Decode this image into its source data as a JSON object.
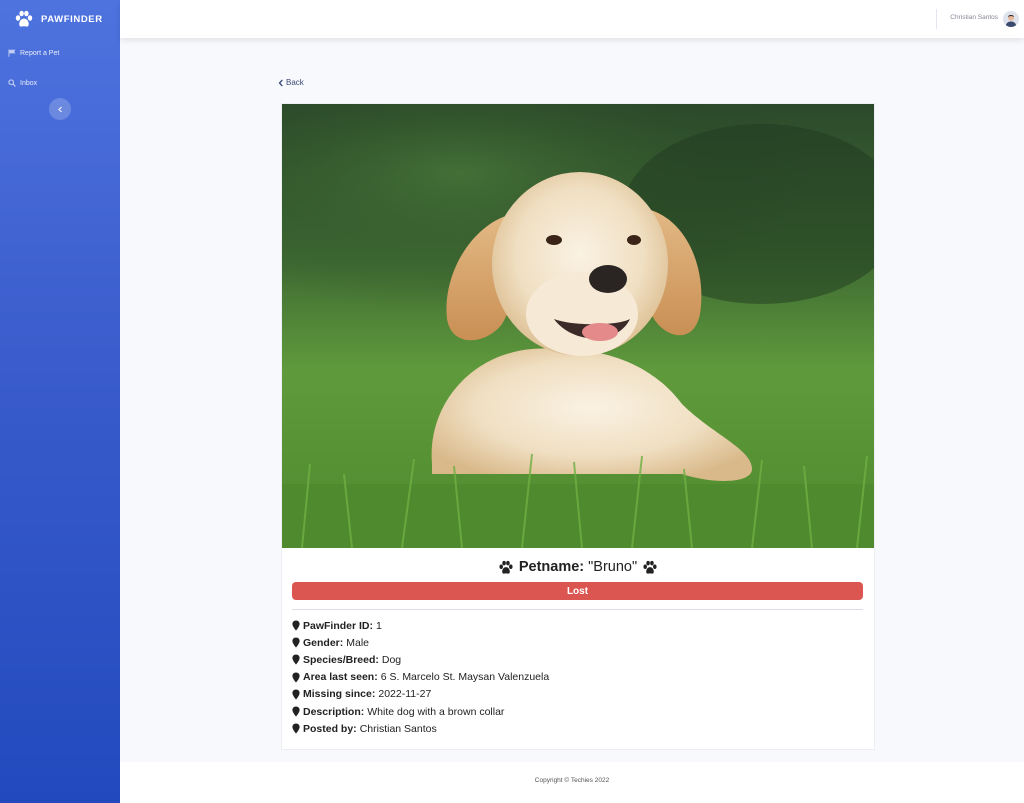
{
  "brand": {
    "name": "PAWFINDER",
    "icon": "paw-icon"
  },
  "sidebar": {
    "items": [
      {
        "label": "Report a Pet",
        "icon": "flag-icon"
      },
      {
        "label": "Inbox",
        "icon": "search-icon"
      }
    ],
    "toggle_icon": "chevron-left-icon"
  },
  "topbar": {
    "user_name": "Christian Santos",
    "avatar_icon": "user-avatar"
  },
  "back": {
    "label": "Back",
    "icon": "chevron-left-icon"
  },
  "pet": {
    "title_label": "Petname:",
    "name": "\"Bruno\"",
    "status": "Lost",
    "details": [
      {
        "label": "PawFinder ID:",
        "value": "1"
      },
      {
        "label": "Gender:",
        "value": "Male"
      },
      {
        "label": "Species/Breed:",
        "value": "Dog"
      },
      {
        "label": "Area last seen:",
        "value": "6 S. Marcelo St. Maysan Valenzuela"
      },
      {
        "label": "Missing since:",
        "value": "2022-11-27"
      },
      {
        "label": "Description:",
        "value": "White dog with a brown collar"
      },
      {
        "label": "Posted by:",
        "value": "Christian Santos"
      }
    ]
  },
  "footer": {
    "copyright": "Copyright © Techies 2022"
  },
  "colors": {
    "sidebar_top": "#4e73df",
    "sidebar_bottom": "#224abe",
    "status_lost": "#dc5651",
    "background": "#f8f9fc"
  }
}
